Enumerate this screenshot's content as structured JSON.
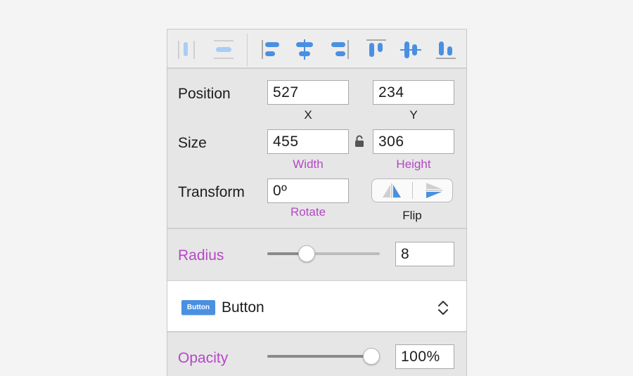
{
  "toolbar": {
    "tools": [
      {
        "name": "distribute-horizontal-icon"
      },
      {
        "name": "distribute-vertical-icon"
      },
      {
        "name": "align-left-icon"
      },
      {
        "name": "align-center-horizontal-icon"
      },
      {
        "name": "align-right-icon"
      },
      {
        "name": "align-top-icon"
      },
      {
        "name": "align-middle-vertical-icon"
      },
      {
        "name": "align-bottom-icon"
      }
    ],
    "accent": "#4a90e2",
    "disabled": "#a9cdf4"
  },
  "position": {
    "label": "Position",
    "x_value": "527",
    "x_caption": "X",
    "y_value": "234",
    "y_caption": "Y"
  },
  "size": {
    "label": "Size",
    "width_value": "455",
    "width_caption": "Width",
    "height_value": "306",
    "height_caption": "Height",
    "lock_icon": "unlocked-padlock-icon"
  },
  "transform": {
    "label": "Transform",
    "rotate_value": "0º",
    "rotate_caption": "Rotate",
    "flip_caption": "Flip"
  },
  "radius": {
    "label": "Radius",
    "value": "8",
    "slider_fraction": 0.32
  },
  "component": {
    "badge": "Button",
    "name": "Button",
    "chevron_icon": "up-down-chevron-icon"
  },
  "opacity": {
    "label": "Opacity",
    "value": "100%",
    "slider_fraction": 1.0
  },
  "colors": {
    "label_purple": "#b548c6",
    "text": "#1c1c1c",
    "panel_bg": "#e6e6e6"
  }
}
